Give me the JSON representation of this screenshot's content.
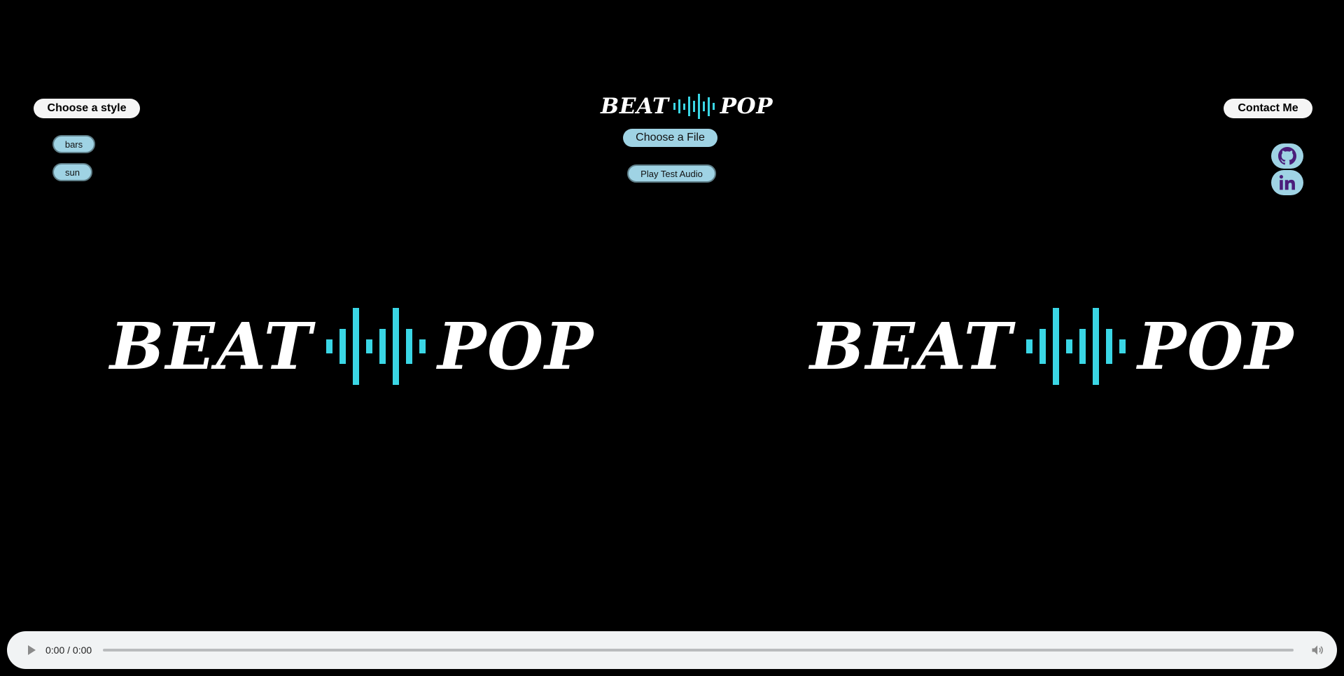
{
  "header": {
    "style_label": "Choose a style",
    "contact_label": "Contact Me",
    "logo": {
      "word1": "BEAT",
      "word2": "POP",
      "wave_icon": "soundwave-icon"
    }
  },
  "styles": {
    "options": [
      "bars",
      "sun"
    ]
  },
  "controls": {
    "choose_file_label": "Choose a File",
    "play_test_label": "Play Test Audio"
  },
  "social": {
    "github_icon": "github-icon",
    "linkedin_icon": "linkedin-icon"
  },
  "player": {
    "time": "0:00 / 0:00",
    "progress": 0
  },
  "colors": {
    "background": "#000000",
    "accent": "#3ad6e5",
    "button_bg": "#9fd3e4",
    "social_icon": "#4b1d7a"
  }
}
